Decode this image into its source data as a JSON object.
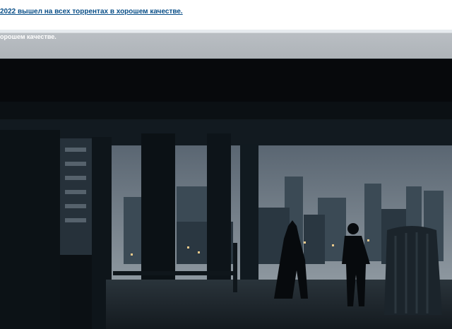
{
  "header": {
    "title_link": "2022 вышел на всех торрентах в хорошем качестве."
  },
  "subheader": {
    "text": "орошем качестве."
  },
  "media": {
    "description": "movie-still"
  }
}
